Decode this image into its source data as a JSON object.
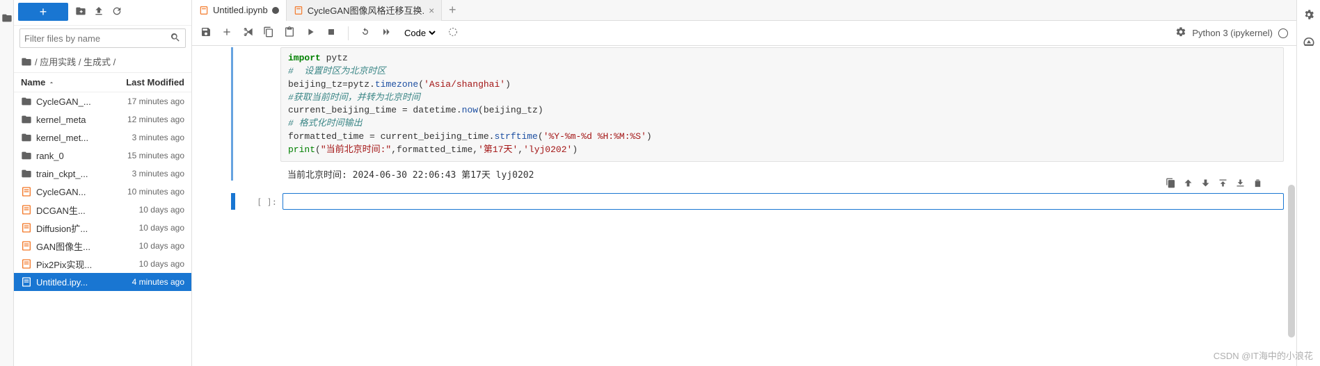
{
  "left_icons": [
    "folder-icon"
  ],
  "file_toolbar": {
    "new_label": "+",
    "icons": [
      "new-folder-icon",
      "upload-icon",
      "refresh-icon"
    ]
  },
  "filter": {
    "placeholder": "Filter files by name"
  },
  "breadcrumb": {
    "path": "/ 应用实践 / 生成式 /"
  },
  "list_header": {
    "name": "Name",
    "modified": "Last Modified"
  },
  "files": [
    {
      "kind": "folder",
      "name": "CycleGAN_...",
      "time": "17 minutes ago",
      "running": false
    },
    {
      "kind": "folder",
      "name": "kernel_meta",
      "time": "12 minutes ago",
      "running": false
    },
    {
      "kind": "folder",
      "name": "kernel_met...",
      "time": "3 minutes ago",
      "running": false
    },
    {
      "kind": "folder",
      "name": "rank_0",
      "time": "15 minutes ago",
      "running": false
    },
    {
      "kind": "folder",
      "name": "train_ckpt_...",
      "time": "3 minutes ago",
      "running": false
    },
    {
      "kind": "notebook",
      "name": "CycleGAN...",
      "time": "10 minutes ago",
      "running": true
    },
    {
      "kind": "notebook",
      "name": "DCGAN生...",
      "time": "10 days ago",
      "running": false
    },
    {
      "kind": "notebook",
      "name": "Diffusion扩...",
      "time": "10 days ago",
      "running": false
    },
    {
      "kind": "notebook",
      "name": "GAN图像生...",
      "time": "10 days ago",
      "running": false
    },
    {
      "kind": "notebook",
      "name": "Pix2Pix实现...",
      "time": "10 days ago",
      "running": false
    },
    {
      "kind": "notebook",
      "name": "Untitled.ipy...",
      "time": "4 minutes ago",
      "running": true,
      "selected": true
    }
  ],
  "tabs": [
    {
      "label": "Untitled.ipynb",
      "dirty": true,
      "active": true
    },
    {
      "label": "CycleGAN图像风格迁移互换.",
      "dirty": false,
      "active": false
    }
  ],
  "nb_toolbar": {
    "cell_type": "Code",
    "kernel": "Python 3 (ipykernel)"
  },
  "code_cell": {
    "lines": [
      {
        "t": "kw",
        "text": "import"
      },
      {
        "t": "",
        "text": " pytz"
      },
      {
        "br": true
      },
      {
        "t": "cmt",
        "text": "#  设置时区为北京时区"
      },
      {
        "br": true
      },
      {
        "t": "",
        "text": "beijing_tz"
      },
      {
        "t": "op",
        "text": "="
      },
      {
        "t": "",
        "text": "pytz"
      },
      {
        "t": "op",
        "text": "."
      },
      {
        "t": "fn",
        "text": "timezone"
      },
      {
        "t": "",
        "text": "("
      },
      {
        "t": "str",
        "text": "'Asia/shanghai'"
      },
      {
        "t": "",
        "text": ")"
      },
      {
        "br": true
      },
      {
        "t": "cmt",
        "text": "#获取当前时间，并转为北京时间"
      },
      {
        "br": true
      },
      {
        "t": "",
        "text": "current_beijing_time "
      },
      {
        "t": "op",
        "text": "="
      },
      {
        "t": "",
        "text": " datetime"
      },
      {
        "t": "op",
        "text": "."
      },
      {
        "t": "fn",
        "text": "now"
      },
      {
        "t": "",
        "text": "(beijing_tz)"
      },
      {
        "br": true
      },
      {
        "t": "cmt",
        "text": "# 格式化时间输出"
      },
      {
        "br": true
      },
      {
        "t": "",
        "text": "formatted_time "
      },
      {
        "t": "op",
        "text": "="
      },
      {
        "t": "",
        "text": " current_beijing_time"
      },
      {
        "t": "op",
        "text": "."
      },
      {
        "t": "fn",
        "text": "strftime"
      },
      {
        "t": "",
        "text": "("
      },
      {
        "t": "str",
        "text": "'%Y-%m-%d %H:%M:%S'"
      },
      {
        "t": "",
        "text": ")"
      },
      {
        "br": true
      },
      {
        "t": "builtin",
        "text": "print"
      },
      {
        "t": "",
        "text": "("
      },
      {
        "t": "str",
        "text": "\"当前北京时间:\""
      },
      {
        "t": "",
        "text": ",formatted_time,"
      },
      {
        "t": "str",
        "text": "'第17天'"
      },
      {
        "t": "",
        "text": ","
      },
      {
        "t": "str",
        "text": "'lyj0202'"
      },
      {
        "t": "",
        "text": ")"
      }
    ],
    "output": "当前北京时间: 2024-06-30 22:06:43 第17天 lyj0202"
  },
  "empty_prompt": "[ ]:",
  "cell_action_icons": [
    "duplicate-icon",
    "move-up-icon",
    "move-down-icon",
    "insert-above-icon",
    "insert-below-icon",
    "delete-icon"
  ],
  "right_icons": [
    "gear-icon",
    "gauge-icon"
  ],
  "watermark": "CSDN @IT海中的小浪花"
}
